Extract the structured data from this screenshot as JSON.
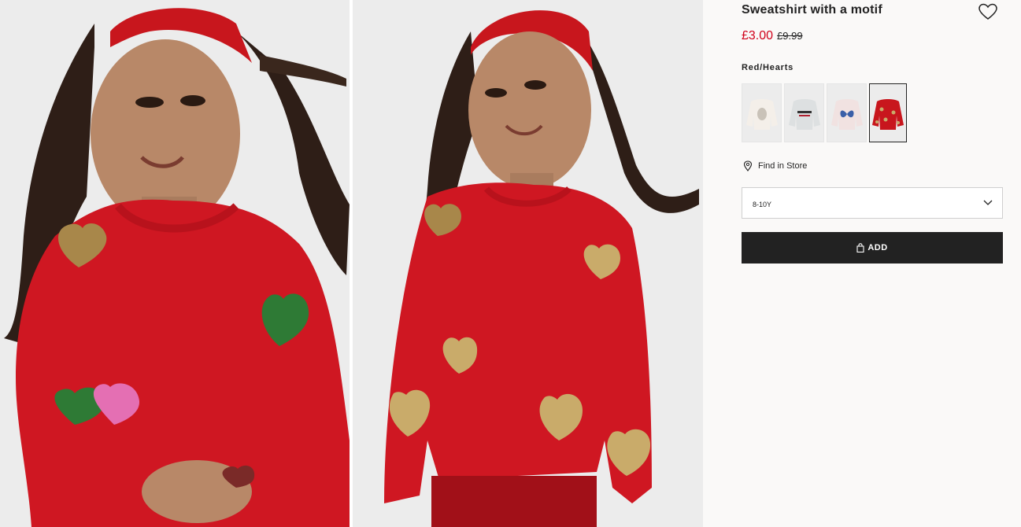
{
  "product": {
    "title": "Sweatshirt with a motif",
    "price": "£3.00",
    "old_price": "£9.99",
    "color_name": "Red/Hearts"
  },
  "swatches": [
    {
      "name": "unicorn-motif",
      "color": "#f1ebe4"
    },
    {
      "name": "text-motif",
      "color": "#e1e3e3"
    },
    {
      "name": "butterfly-motif",
      "color": "#f2e4e3"
    },
    {
      "name": "red-hearts",
      "color": "#c8161d",
      "selected": true
    }
  ],
  "store": {
    "label": "Find in Store",
    "icon": "location-pin-icon"
  },
  "size": {
    "selected": "8-10Y",
    "icon": "chevron-down-icon"
  },
  "add_button": {
    "label": "ADD",
    "icon": "shopping-bag-icon"
  },
  "favorite": {
    "icon": "heart-outline-icon"
  },
  "colors": {
    "price_red": "#d0021b",
    "button_bg": "#222222",
    "panel_bg": "#faf9f8",
    "sweatshirt_red": "#cf1722"
  }
}
